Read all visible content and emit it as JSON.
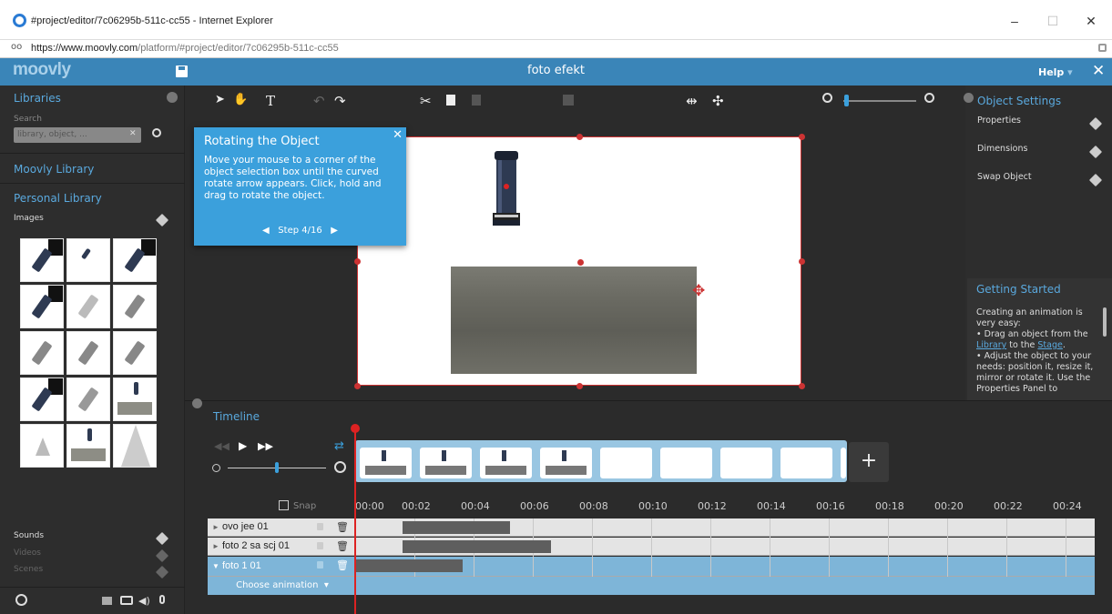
{
  "window": {
    "title": "#project/editor/7c06295b-511c-cc55 - Internet Explorer",
    "min": "–",
    "max": "☐",
    "close": "✕"
  },
  "address": {
    "scheme": "https://www.",
    "host": "moovly.com",
    "path": "/platform/#project/editor/7c06295b-511c-cc55"
  },
  "app": {
    "logo": "moovly",
    "project_name": "foto efekt",
    "help": "Help",
    "help_arrow": "▾",
    "close": "✕"
  },
  "left": {
    "libraries": "Libraries",
    "search_label": "Search",
    "search_placeholder": "library, object, ...",
    "search_clear": "✕",
    "moovly_library": "Moovly Library",
    "personal_library": "Personal Library",
    "images": "Images",
    "sounds": "Sounds",
    "videos": "Videos",
    "scenes": "Scenes"
  },
  "tooltip": {
    "title": "Rotating the Object",
    "body": "Move your mouse to a corner of the object selection box until the curved rotate arrow appears. Click, hold and drag to rotate the object.",
    "step": "Step 4/16",
    "prev": "◀",
    "next": "▶",
    "close": "✕"
  },
  "right": {
    "object_settings": "Object Settings",
    "properties": "Properties",
    "dimensions": "Dimensions",
    "swap_object": "Swap Object",
    "getting_started": "Getting Started",
    "gs_intro": "Creating an animation is very easy:",
    "gs_b1_pre": "Drag an object from the ",
    "gs_b1_link1": "Library",
    "gs_b1_mid": " to the ",
    "gs_b1_link2": "Stage",
    "gs_b1_post": ".",
    "gs_b2": "Adjust the object to your needs: position it, resize it, mirror or rotate it. Use the Properties Panel to"
  },
  "timeline": {
    "title": "Timeline",
    "snap": "Snap",
    "ticks": [
      "00:00",
      "00:02",
      "00:04",
      "00:06",
      "00:08",
      "00:10",
      "00:12",
      "00:14",
      "00:16",
      "00:18",
      "00:20",
      "00:22",
      "00:24"
    ],
    "tracks": [
      {
        "name": "ovo jee 01",
        "arrow": "►"
      },
      {
        "name": "foto 2 sa scj 01",
        "arrow": "►"
      },
      {
        "name": "foto 1 01",
        "arrow": "▼"
      }
    ],
    "choose_animation": "Choose animation",
    "choose_arrow": "▾",
    "add": "+"
  },
  "colors": {
    "accent": "#3a85b8",
    "tooltip": "#3ba0dc",
    "playhead": "#d22222"
  }
}
